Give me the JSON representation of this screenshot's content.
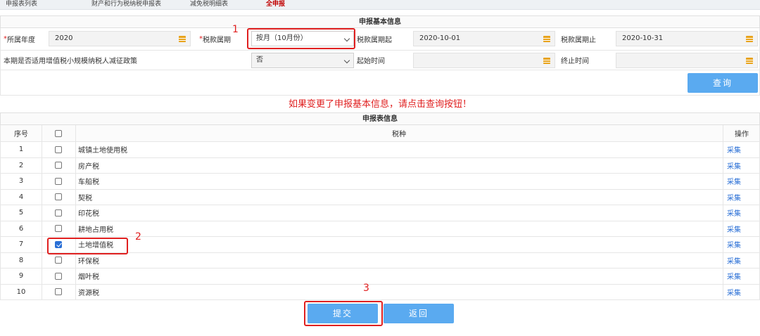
{
  "topnav": {
    "items": [
      "申报表列表",
      "财产和行为税纳税申报表",
      "减免税明细表",
      "全申报"
    ]
  },
  "basic_info": {
    "title": "申报基本信息",
    "required_mark": "*",
    "fiscal_year_label": "所属年度",
    "fiscal_year_value": "2020",
    "tax_period_label": "税款属期",
    "tax_period_value": "按月（10月份）",
    "period_start_label": "税款属期起",
    "period_start_value": "2020-10-01",
    "period_end_label": "税款属期止",
    "period_end_value": "2020-10-31",
    "policy_label": "本期是否适用增值税小规模纳税人减征政策",
    "policy_value": "否",
    "start_time_label": "起始时间",
    "start_time_value": "",
    "end_time_label": "终止时间",
    "end_time_value": "",
    "query_button": "查询"
  },
  "notice": "如果变更了申报基本信息，请点击查询按钮！",
  "table": {
    "title": "申报表信息",
    "headers": {
      "index": "序号",
      "tax_type": "税种",
      "action": "操作"
    },
    "action_label": "采集",
    "rows": [
      {
        "index": "1",
        "name": "城镇土地使用税",
        "checked": false
      },
      {
        "index": "2",
        "name": "房产税",
        "checked": false
      },
      {
        "index": "3",
        "name": "车船税",
        "checked": false
      },
      {
        "index": "4",
        "name": "契税",
        "checked": false
      },
      {
        "index": "5",
        "name": "印花税",
        "checked": false
      },
      {
        "index": "6",
        "name": "耕地占用税",
        "checked": false
      },
      {
        "index": "7",
        "name": "土地增值税",
        "checked": true
      },
      {
        "index": "8",
        "name": "环保税",
        "checked": false
      },
      {
        "index": "9",
        "name": "烟叶税",
        "checked": false
      },
      {
        "index": "10",
        "name": "资源税",
        "checked": false
      }
    ]
  },
  "footer": {
    "submit_button": "提交",
    "back_button": "返回"
  },
  "annotations": {
    "one": "1",
    "two": "2",
    "three": "3"
  },
  "colors": {
    "accent": "#5aaaf0",
    "annotation": "#e02020",
    "link": "#2a6fd6",
    "calendar": "#e8a31b"
  },
  "icons": {
    "calendar": "calendar-icon",
    "dropdown": "chevron-down-icon",
    "checkbox": "checkbox-icon"
  }
}
